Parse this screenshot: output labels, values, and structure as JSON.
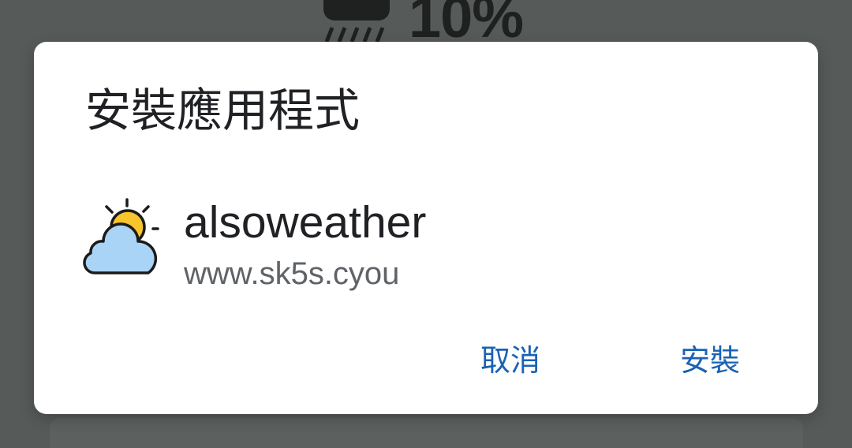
{
  "background": {
    "weather_widget": {
      "icon": "rain-icon",
      "precipitation": "10%"
    }
  },
  "dialog": {
    "title": "安裝應用程式",
    "app": {
      "icon": "weather-sun-cloud-icon",
      "name": "alsoweather",
      "source": "www.sk5s.cyou"
    },
    "buttons": {
      "cancel_label": "取消",
      "install_label": "安裝"
    }
  },
  "colors": {
    "scrim": "#565a59",
    "dialog_background": "#ffffff",
    "accent": "#1a62b4",
    "primary_text": "#202124",
    "secondary_text": "#5f6368",
    "sun": "#f8c52c",
    "cloud": "#a9d4f6"
  }
}
